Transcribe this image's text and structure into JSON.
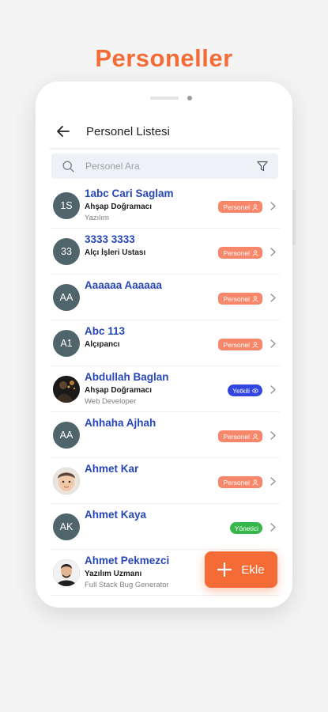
{
  "promo": {
    "title": "Personeller"
  },
  "appbar": {
    "title": "Personel Listesi"
  },
  "search": {
    "placeholder": "Personel Ara"
  },
  "colors": {
    "accent": "#f46b35",
    "name": "#2747b8",
    "personel_badge": "#f6876a",
    "yetkili_badge": "#3346e0",
    "yonetici_badge": "#36b64b"
  },
  "people": [
    {
      "initials": "1S",
      "name": "1abc Cari Saglam",
      "title": "Ahşap Doğramacı",
      "subtitle": "Yazılım",
      "badge": "Personel",
      "badge_type": "personel"
    },
    {
      "initials": "33",
      "name": "3333 3333",
      "title": "Alçı İşleri Ustası",
      "subtitle": "",
      "badge": "Personel",
      "badge_type": "personel"
    },
    {
      "initials": "AA",
      "name": "Aaaaaa Aaaaaa",
      "title": "",
      "subtitle": "",
      "badge": "Personel",
      "badge_type": "personel"
    },
    {
      "initials": "A1",
      "name": "Abc 113",
      "title": "Alçıpancı",
      "subtitle": "",
      "badge": "Personel",
      "badge_type": "personel"
    },
    {
      "initials": "",
      "name": "Abdullah Baglan",
      "title": "Ahşap Doğramacı",
      "subtitle": "Web Developer",
      "badge": "Yetkili",
      "badge_type": "yetkili",
      "photo": "dark"
    },
    {
      "initials": "AA",
      "name": "Ahhaha Ajhah",
      "title": "",
      "subtitle": "",
      "badge": "Personel",
      "badge_type": "personel"
    },
    {
      "initials": "",
      "name": "Ahmet Kar",
      "title": "",
      "subtitle": "",
      "badge": "Personel",
      "badge_type": "personel",
      "photo": "child"
    },
    {
      "initials": "AK",
      "name": "Ahmet Kaya",
      "title": "",
      "subtitle": "",
      "badge": "Yönetici",
      "badge_type": "yonetici"
    },
    {
      "initials": "",
      "name": "Ahmet Pekmezci",
      "title": "Yazılım Uzmanı",
      "subtitle": "Full Stack Bug Generator",
      "badge": "",
      "badge_type": "",
      "photo": "man"
    }
  ],
  "fab": {
    "label": "Ekle",
    "icon": "plus-icon"
  }
}
